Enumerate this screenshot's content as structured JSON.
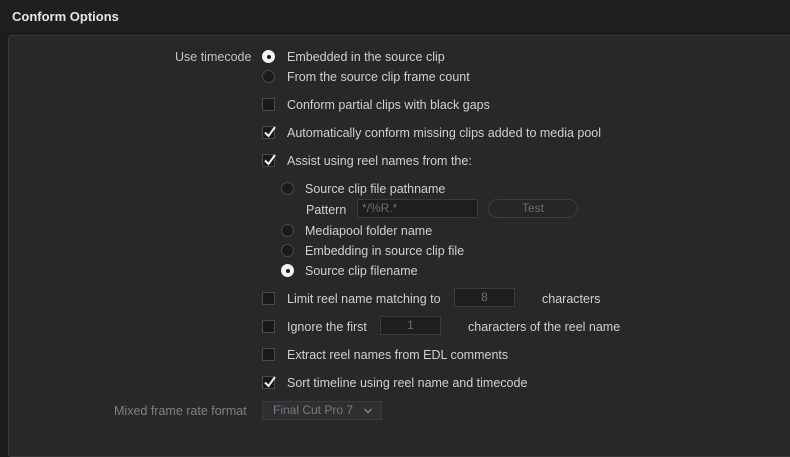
{
  "header": {
    "title": "Conform Options"
  },
  "use_timecode": {
    "label": "Use timecode",
    "options": [
      {
        "label": "Embedded in the source clip",
        "selected": true
      },
      {
        "label": "From the source clip frame count",
        "selected": false
      }
    ]
  },
  "checkboxes": {
    "conform_partial": {
      "label": "Conform partial clips with black gaps",
      "checked": false
    },
    "auto_conform": {
      "label": "Automatically conform missing clips added to media pool",
      "checked": true
    },
    "assist_reel": {
      "label": "Assist using reel names from the:",
      "checked": true
    }
  },
  "reel_source": {
    "options": [
      {
        "label": "Source clip file pathname",
        "selected": false
      },
      {
        "label": "Mediapool folder name",
        "selected": false
      },
      {
        "label": "Embedding in source clip file",
        "selected": false
      },
      {
        "label": "Source clip filename",
        "selected": true
      }
    ],
    "pattern_label": "Pattern",
    "pattern_value": "*/%R.*",
    "test_button": "Test"
  },
  "limit_reel": {
    "label": "Limit reel name matching to",
    "value": "8",
    "suffix": "characters",
    "checked": false
  },
  "ignore_first": {
    "label": "Ignore the first",
    "value": "1",
    "suffix": "characters of the reel name",
    "checked": false
  },
  "extract_edl": {
    "label": "Extract reel names from EDL comments",
    "checked": false
  },
  "sort_timeline": {
    "label": "Sort timeline using reel name and timecode",
    "checked": true
  },
  "mixed_frame": {
    "label": "Mixed frame rate format",
    "value": "Final Cut Pro 7"
  }
}
